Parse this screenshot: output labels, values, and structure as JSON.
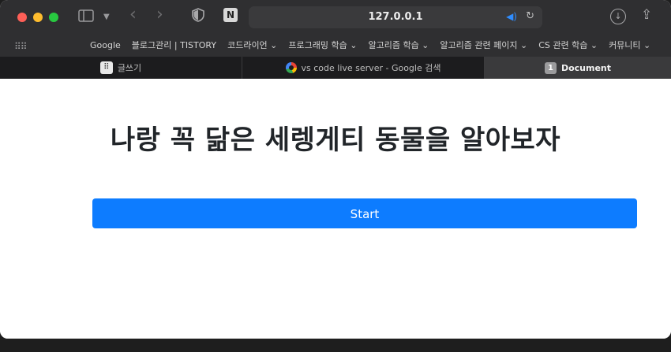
{
  "browser": {
    "url": "127.0.0.1",
    "bookmarks": [
      "Google",
      "블로그관리 | TISTORY",
      "코드라이언 ⌄",
      "프로그래밍 학습 ⌄",
      "알고리즘 학습 ⌄",
      "알고리즘 관련 페이지 ⌄",
      "CS 관련 학습 ⌄",
      "커뮤니티 ⌄"
    ],
    "tabs": [
      {
        "label": "글쓰기",
        "icon": "tistory-dots-icon"
      },
      {
        "label": "vs code live server - Google 검색",
        "icon": "google-icon"
      },
      {
        "label": "Document",
        "icon": "number-badge-icon",
        "badge": "1",
        "active": true
      }
    ]
  },
  "page": {
    "title": "나랑 꼭 닮은 세렝게티 동물을 알아보자",
    "start_button": "Start"
  },
  "colors": {
    "button_bg": "#0d7cff",
    "title_text": "#212529",
    "toolbar_bg": "#2f2f31"
  }
}
